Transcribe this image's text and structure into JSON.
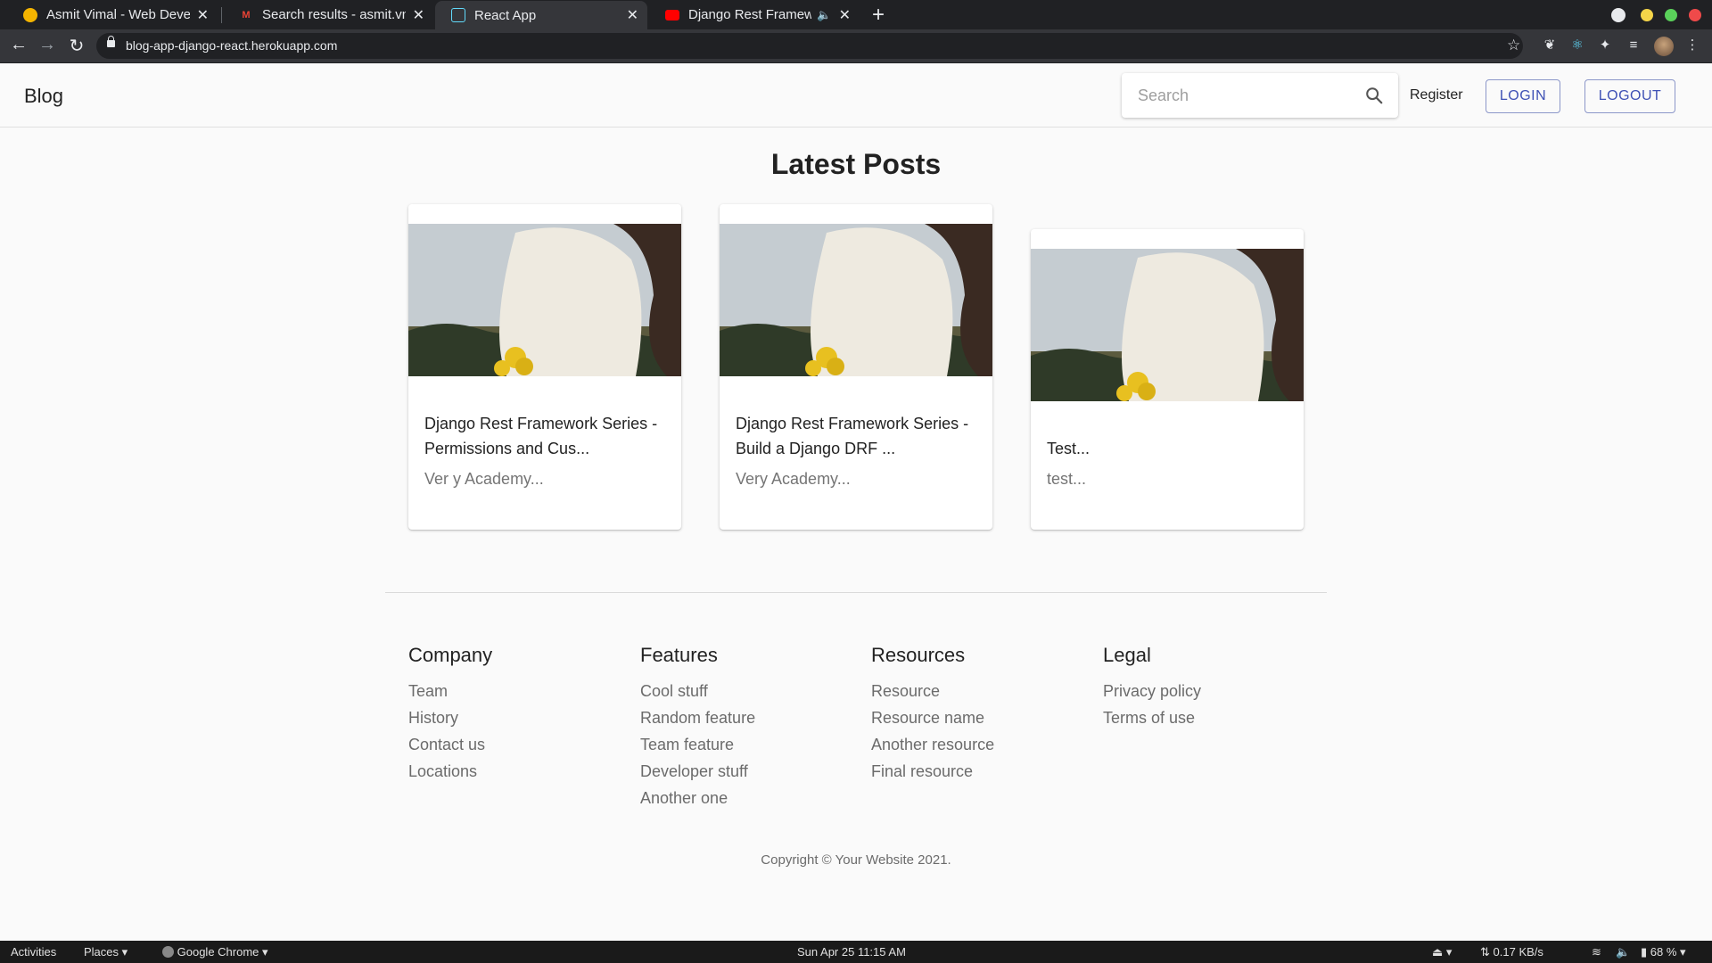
{
  "browser": {
    "tabs": [
      {
        "title": "Asmit Vimal - Web Develo",
        "favicon_color": "#f4b400"
      },
      {
        "title": "Search results - asmit.vml",
        "favicon_color": "#ea4335"
      },
      {
        "title": "React App",
        "favicon_color": "#61dafb"
      },
      {
        "title": "Django Rest Framewo",
        "favicon_color": "#ff0000"
      }
    ],
    "url": "blog-app-django-react.herokuapp.com"
  },
  "appbar": {
    "brand": "Blog",
    "search_placeholder": "Search",
    "register_label": "Register",
    "login_label": "LOGIN",
    "logout_label": "LOGOUT"
  },
  "main": {
    "heading": "Latest Posts",
    "posts": [
      {
        "title": "Django Rest Framework Series - Permissions and Cus...",
        "excerpt": "Ver y Academy..."
      },
      {
        "title": "Django Rest Framework Series - Build a Django DRF ...",
        "excerpt": "Very Academy..."
      },
      {
        "title": "Test...",
        "excerpt": "test..."
      }
    ]
  },
  "footer": {
    "columns": [
      {
        "heading": "Company",
        "links": [
          "Team",
          "History",
          "Contact us",
          "Locations"
        ]
      },
      {
        "heading": "Features",
        "links": [
          "Cool stuff",
          "Random feature",
          "Team feature",
          "Developer stuff",
          "Another one"
        ]
      },
      {
        "heading": "Resources",
        "links": [
          "Resource",
          "Resource name",
          "Another resource",
          "Final resource"
        ]
      },
      {
        "heading": "Legal",
        "links": [
          "Privacy policy",
          "Terms of use"
        ]
      }
    ],
    "copyright": "Copyright © Your Website 2021."
  },
  "taskbar": {
    "activities": "Activities",
    "places": "Places",
    "app_name": "Google Chrome",
    "datetime": "Sun Apr 25  11:15 AM",
    "network_speed": "0.17 KB/s",
    "battery": "68 %"
  },
  "colors": {
    "accent": "#3f51b5",
    "chrome_dark": "#202124",
    "chrome_toolbar": "#35363a"
  }
}
